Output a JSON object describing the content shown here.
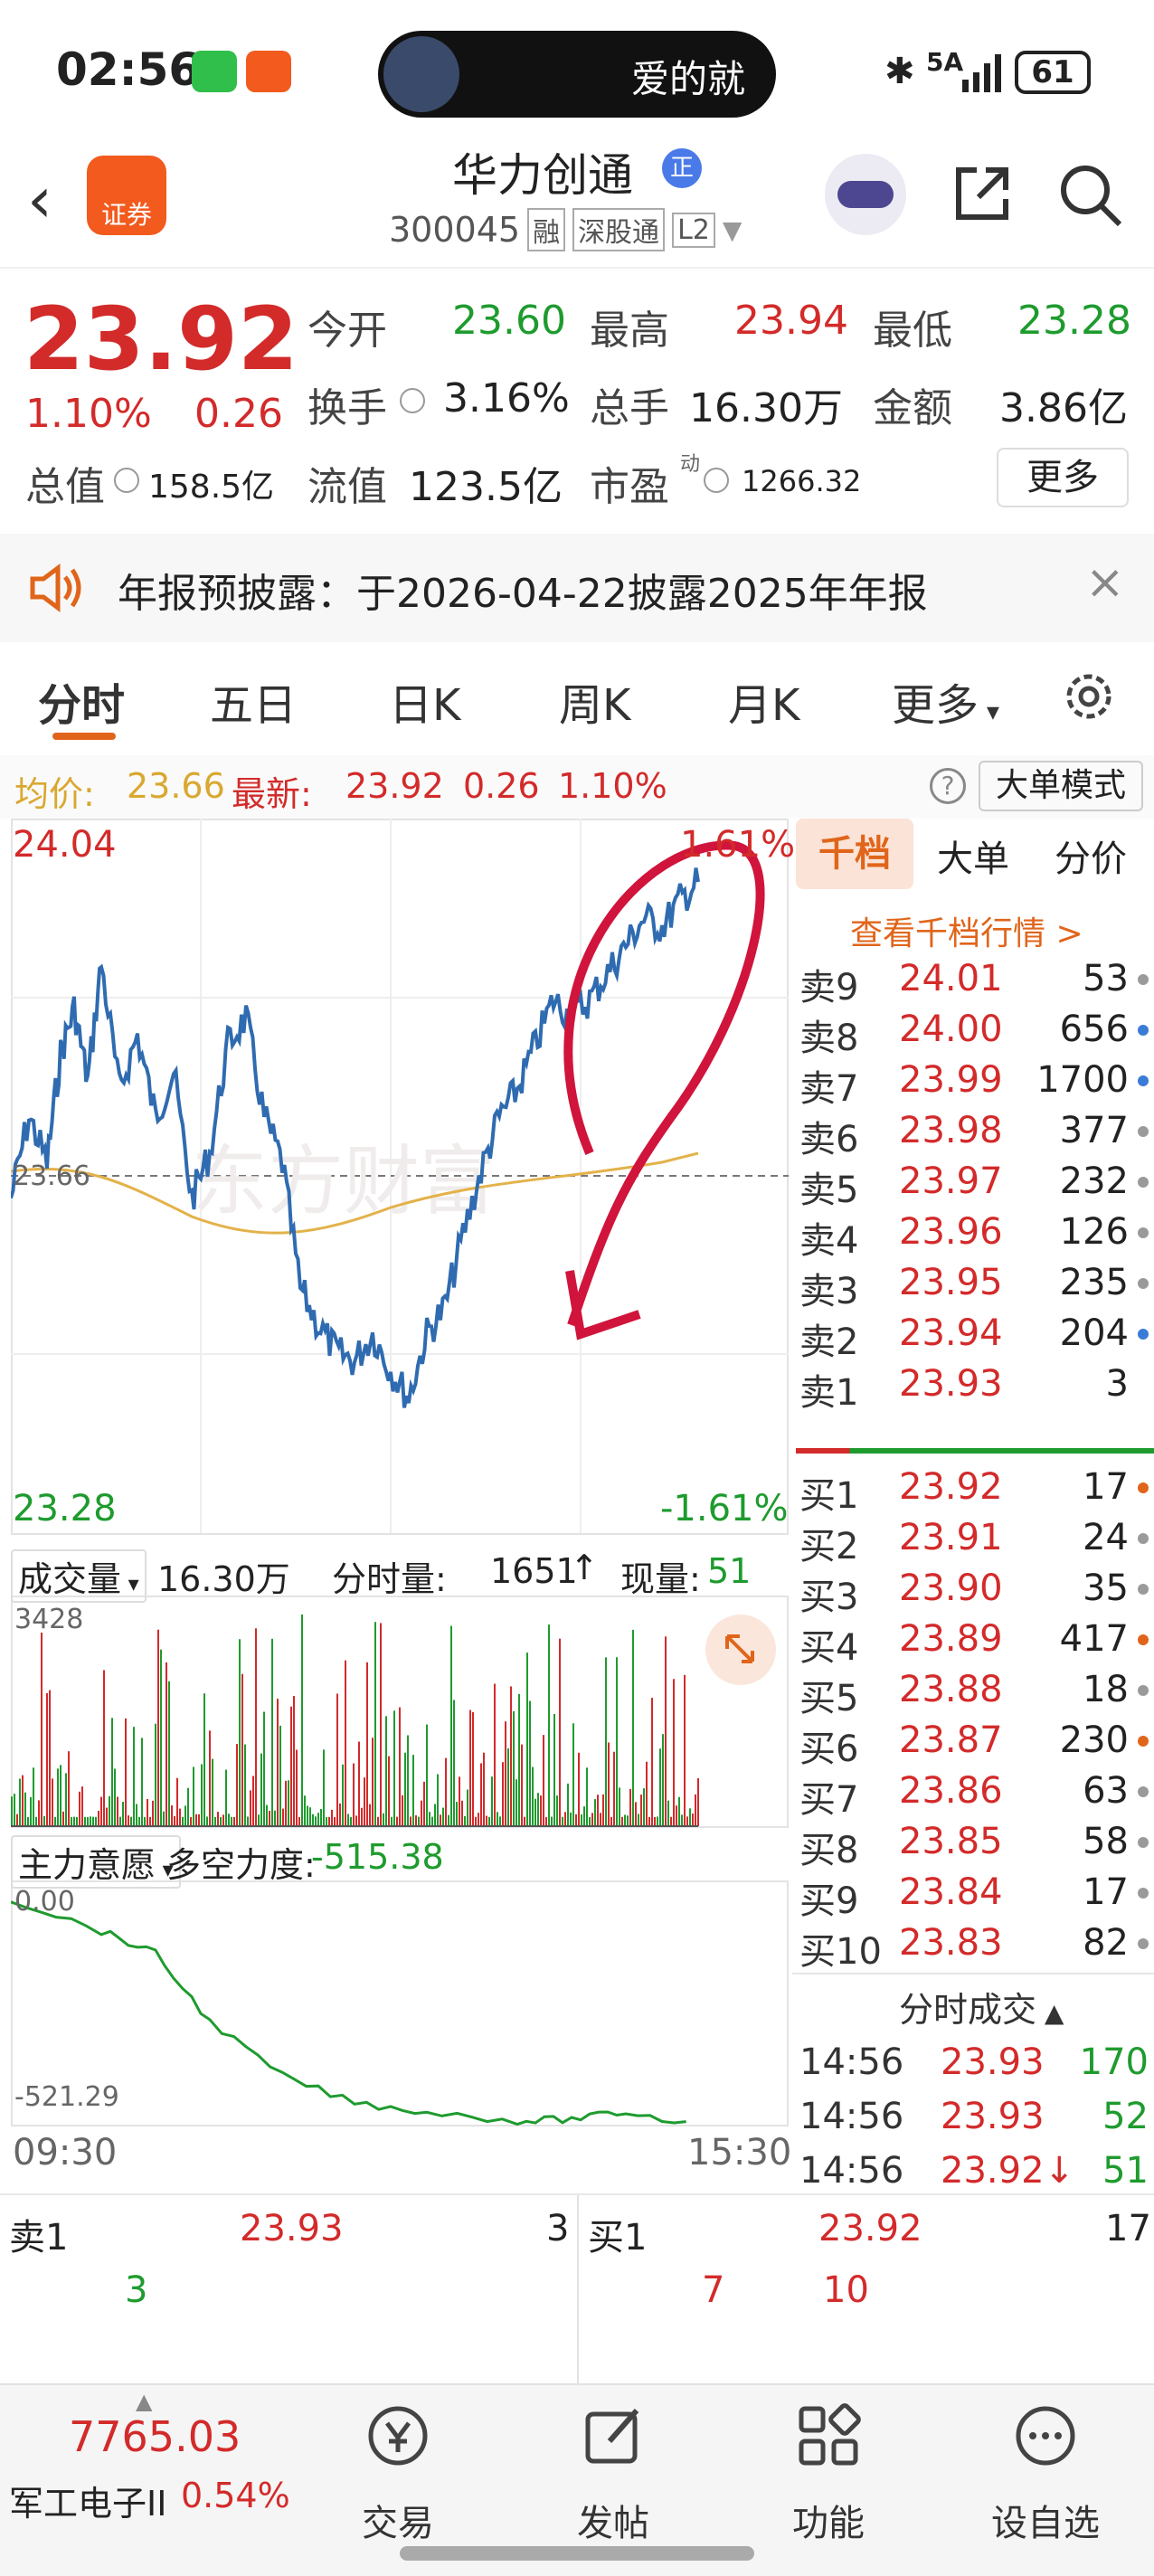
{
  "status_bar": {
    "time": "02:56",
    "media_text": "爱的就",
    "network": "5A",
    "battery": "61"
  },
  "header": {
    "stock_name": "华力创通",
    "badge": "正",
    "code": "300045",
    "tags": [
      "融",
      "深股通",
      "L2"
    ],
    "logo_text": "证券"
  },
  "quote": {
    "price": "23.92",
    "change_pct": "1.10%",
    "change": "0.26",
    "open_label": "今开",
    "open": "23.60",
    "high_label": "最高",
    "high": "23.94",
    "low_label": "最低",
    "low": "23.28",
    "turnover_label": "换手",
    "turnover": "3.16%",
    "volume_label": "总手",
    "volume": "16.30万",
    "amount_label": "金额",
    "amount": "3.86亿",
    "mcap_label": "总值",
    "mcap": "158.5亿",
    "float_label": "流值",
    "float_cap": "123.5亿",
    "pe_label": "市盈",
    "pe_sup": "动",
    "pe": "1266.32",
    "more_button": "更多"
  },
  "notice": {
    "text": "年报预披露：于2026-04-22披露2025年年报"
  },
  "tabs": [
    "分时",
    "五日",
    "日K",
    "周K",
    "月K",
    "更多"
  ],
  "avg_line": {
    "avg_label": "均价:",
    "avg": "23.66",
    "latest_label": "最新:",
    "latest": "23.92",
    "chg": "0.26",
    "pct": "1.10%",
    "mode_button": "大单模式"
  },
  "price_chart": {
    "y_high": "24.04",
    "y_low": "23.28",
    "pct_high": "1.61%",
    "pct_low": "-1.61%",
    "mid": "23.66",
    "watermark": "东方财富"
  },
  "volume_bar": {
    "label": "成交量",
    "total": "16.30万",
    "tick_label": "分时量:",
    "tick": "1651",
    "cur_label": "现量:",
    "cur": "51",
    "ymax": "3428"
  },
  "force": {
    "label": "主力意愿",
    "ls_label": "多空力度:",
    "ls": "-515.38",
    "top": "0.00",
    "bottom": "-521.29"
  },
  "time_axis": {
    "start": "09:30",
    "end": "15:30"
  },
  "book_tabs": [
    "千档",
    "大单",
    "分价"
  ],
  "book_link": "查看千档行情 >",
  "sells": [
    {
      "label": "卖9",
      "price": "24.01",
      "vol": "53",
      "dot": "#9a9a9a"
    },
    {
      "label": "卖8",
      "price": "24.00",
      "vol": "656",
      "dot": "#3a7bd5"
    },
    {
      "label": "卖7",
      "price": "23.99",
      "vol": "1700",
      "dot": "#3a7bd5"
    },
    {
      "label": "卖6",
      "price": "23.98",
      "vol": "377",
      "dot": "#9a9a9a"
    },
    {
      "label": "卖5",
      "price": "23.97",
      "vol": "232",
      "dot": "#9a9a9a"
    },
    {
      "label": "卖4",
      "price": "23.96",
      "vol": "126",
      "dot": "#9a9a9a"
    },
    {
      "label": "卖3",
      "price": "23.95",
      "vol": "235",
      "dot": "#9a9a9a"
    },
    {
      "label": "卖2",
      "price": "23.94",
      "vol": "204",
      "dot": "#3a7bd5"
    },
    {
      "label": "卖1",
      "price": "23.93",
      "vol": "3",
      "dot": ""
    }
  ],
  "buys": [
    {
      "label": "买1",
      "price": "23.92",
      "vol": "17",
      "dot": "#e0651a"
    },
    {
      "label": "买2",
      "price": "23.91",
      "vol": "24",
      "dot": "#9a9a9a"
    },
    {
      "label": "买3",
      "price": "23.90",
      "vol": "35",
      "dot": "#9a9a9a"
    },
    {
      "label": "买4",
      "price": "23.89",
      "vol": "417",
      "dot": "#e0651a"
    },
    {
      "label": "买5",
      "price": "23.88",
      "vol": "18",
      "dot": "#9a9a9a"
    },
    {
      "label": "买6",
      "price": "23.87",
      "vol": "230",
      "dot": "#e0651a"
    },
    {
      "label": "买7",
      "price": "23.86",
      "vol": "63",
      "dot": "#9a9a9a"
    },
    {
      "label": "买8",
      "price": "23.85",
      "vol": "58",
      "dot": "#9a9a9a"
    },
    {
      "label": "买9",
      "price": "23.84",
      "vol": "17",
      "dot": "#9a9a9a"
    },
    {
      "label": "买10",
      "price": "23.83",
      "vol": "82",
      "dot": "#9a9a9a"
    }
  ],
  "trades_title": "分时成交",
  "trades": [
    {
      "time": "14:56",
      "price": "23.93",
      "vol": "170"
    },
    {
      "time": "14:56",
      "price": "23.93",
      "vol": "52"
    },
    {
      "time": "14:56",
      "price": "23.92↓",
      "vol": "51"
    }
  ],
  "bottom_strip": {
    "sell_label": "卖1",
    "sell_price": "23.93",
    "sell_vol": "3",
    "sell_sub": "3",
    "buy_label": "买1",
    "buy_price": "23.92",
    "buy_vol": "17",
    "buy_sub1": "7",
    "buy_sub2": "10"
  },
  "bottom_nav": {
    "index_value": "7765.03",
    "index_name": "军工电子II",
    "index_pct": "0.54%",
    "items": [
      "交易",
      "发帖",
      "功能",
      "设自选"
    ]
  }
}
